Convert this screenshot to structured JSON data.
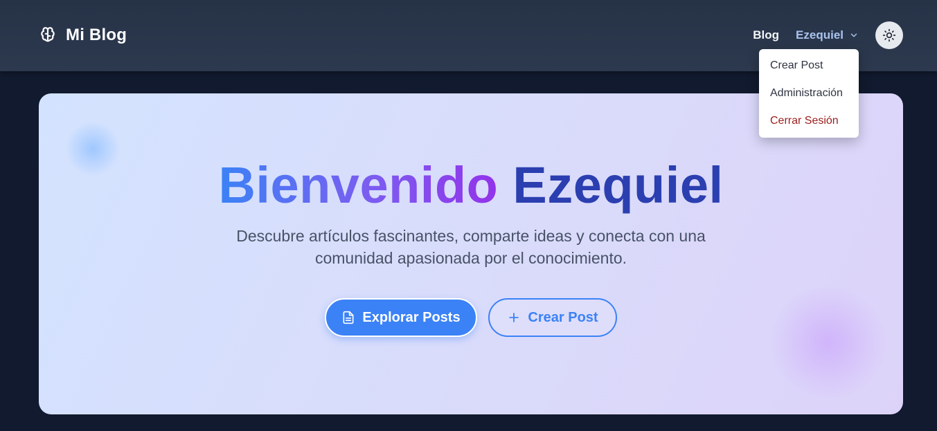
{
  "header": {
    "brand": "Mi Blog",
    "brand_icon": "brain-icon",
    "nav_blog": "Blog",
    "user_name": "Ezequiel",
    "theme_icon": "sun-icon"
  },
  "user_menu": {
    "items": [
      {
        "label": "Crear Post"
      },
      {
        "label": "Administración"
      },
      {
        "label": "Cerrar Sesión"
      }
    ]
  },
  "hero": {
    "title_greeting": "Bienvenido",
    "title_name": "Ezequiel",
    "subtitle": "Descubre artículos fascinantes, comparte ideas y conecta con una comunidad apasionada por el conocimiento.",
    "primary_button": "Explorar Posts",
    "secondary_button": "Crear Post"
  },
  "colors": {
    "accent": "#3b82f6",
    "title_gradient_start": "#3b82f6",
    "title_gradient_end": "#9333ea",
    "title_name": "#2b3fb0",
    "danger": "#9b1c1c"
  }
}
